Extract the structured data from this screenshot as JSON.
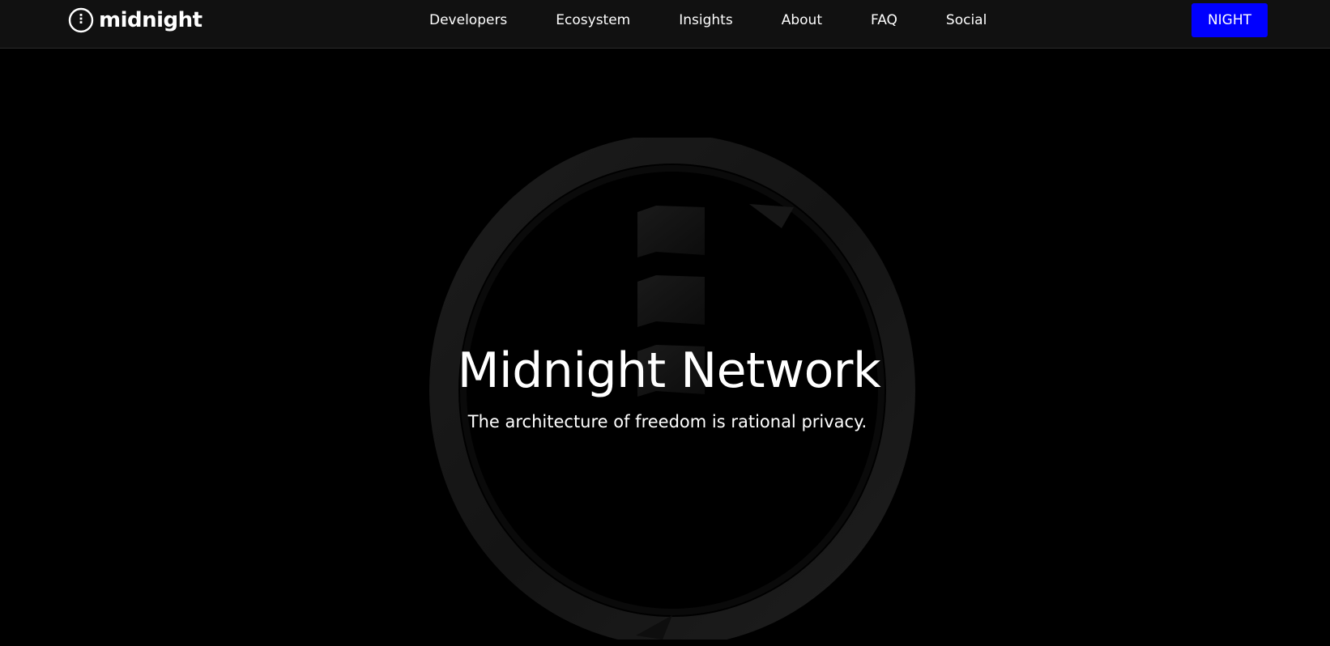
{
  "header": {
    "logo_text": "midnight",
    "logo_icon": "midnight-logo-icon",
    "nav": [
      {
        "label": "Developers"
      },
      {
        "label": "Ecosystem"
      },
      {
        "label": "Insights"
      },
      {
        "label": "About"
      },
      {
        "label": "FAQ"
      },
      {
        "label": "Social"
      }
    ],
    "cta_label": "NIGHT"
  },
  "hero": {
    "title": "Midnight Network",
    "subtitle": "The architecture of freedom is rational privacy."
  },
  "colors": {
    "background": "#000000",
    "navbar": "#111111",
    "accent": "#0000ff",
    "text": "#ffffff"
  }
}
